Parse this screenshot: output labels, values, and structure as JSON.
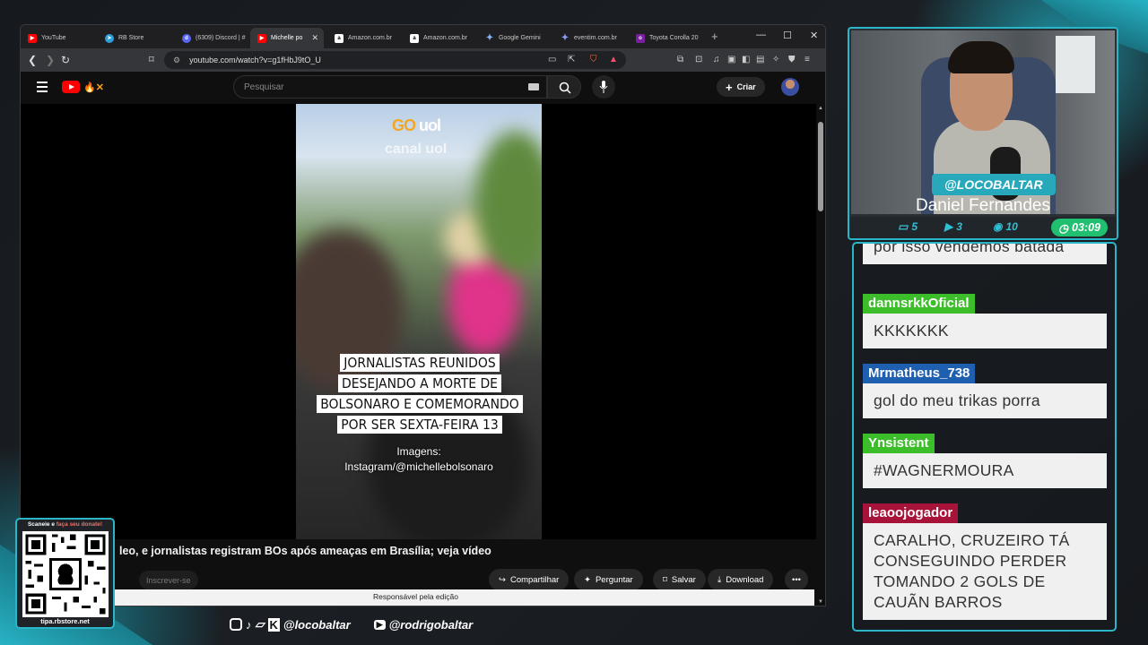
{
  "browser": {
    "tabs": [
      {
        "label": "YouTube",
        "fav_color": "#ff0000"
      },
      {
        "label": "RB Store",
        "fav_color": "#2d9ed8"
      },
      {
        "label": "(6309) Discord | # ",
        "fav_color": "#5865f2"
      },
      {
        "label": "Michelle po",
        "fav_color": "#ff0000",
        "active": true
      },
      {
        "label": "Amazon.com.br",
        "fav_color": "#ffffff"
      },
      {
        "label": "Amazon.com.br",
        "fav_color": "#ffffff"
      },
      {
        "label": "Google Gemini",
        "fav_color": "#8ab4f8"
      },
      {
        "label": "eventim.com.br",
        "fav_color": "#1a2a8a"
      },
      {
        "label": "Toyota Corolla 20",
        "fav_color": "#7b1fa2"
      }
    ],
    "url": "youtube.com/watch?v=g1fHbJ9tO_U"
  },
  "youtube": {
    "search_placeholder": "Pesquisar",
    "create_label": "Criar",
    "video": {
      "logo": "GO",
      "logo_suffix": "uol",
      "canal": "canal uol",
      "caption": "JORNALISTAS REUNIDOS DESEJANDO A MORTE DE BOLSONARO E COMEMORANDO POR SER SEXTA-FEIRA 13",
      "credit_line1": "Imagens:",
      "credit_line2": "Instagram/@michellebolsonaro"
    },
    "title": "leo, e jornalistas registram BOs após ameaças em Brasília; veja vídeo",
    "subscribe_label": "Inscrever-se",
    "actions": {
      "share": "Compartilhar",
      "ask": "Perguntar",
      "save": "Salvar",
      "download": "Download"
    },
    "description_snippet": "Responsável pela edição"
  },
  "stream": {
    "handle": "@LOCOBALTAR",
    "name": "Daniel Fernandes",
    "stats": {
      "chat": "5",
      "video": "3",
      "viewers": "10"
    },
    "timer": "03:09",
    "accent": "#2bb5c8"
  },
  "chat": {
    "messages": [
      {
        "user": "",
        "text": "por isso vendemos batada"
      },
      {
        "user": "dannsrkkOficial",
        "color": "#3cbd2a",
        "text": "KKKKKKK"
      },
      {
        "user": "Mrmatheus_738",
        "color": "#1f5fb0",
        "text": "gol do meu trikas porra"
      },
      {
        "user": "Ynsistent",
        "color": "#3cbd2a",
        "text": "#WAGNERMOURA"
      },
      {
        "user": "leaoojogador",
        "color": "#a8133a",
        "text": "CARALHO, CRUZEIRO TÁ CONSEGUINDO PERDER TOMANDO 2 GOLS DE CAUÃN BARROS"
      }
    ]
  },
  "qr": {
    "top_text": "Scaneie e ",
    "top_highlight": "faça seu donate!",
    "bottom_text": "tipa.rbstore.net"
  },
  "socials": {
    "handle1": "@locobaltar",
    "handle2": "@rodrigobaltar"
  }
}
